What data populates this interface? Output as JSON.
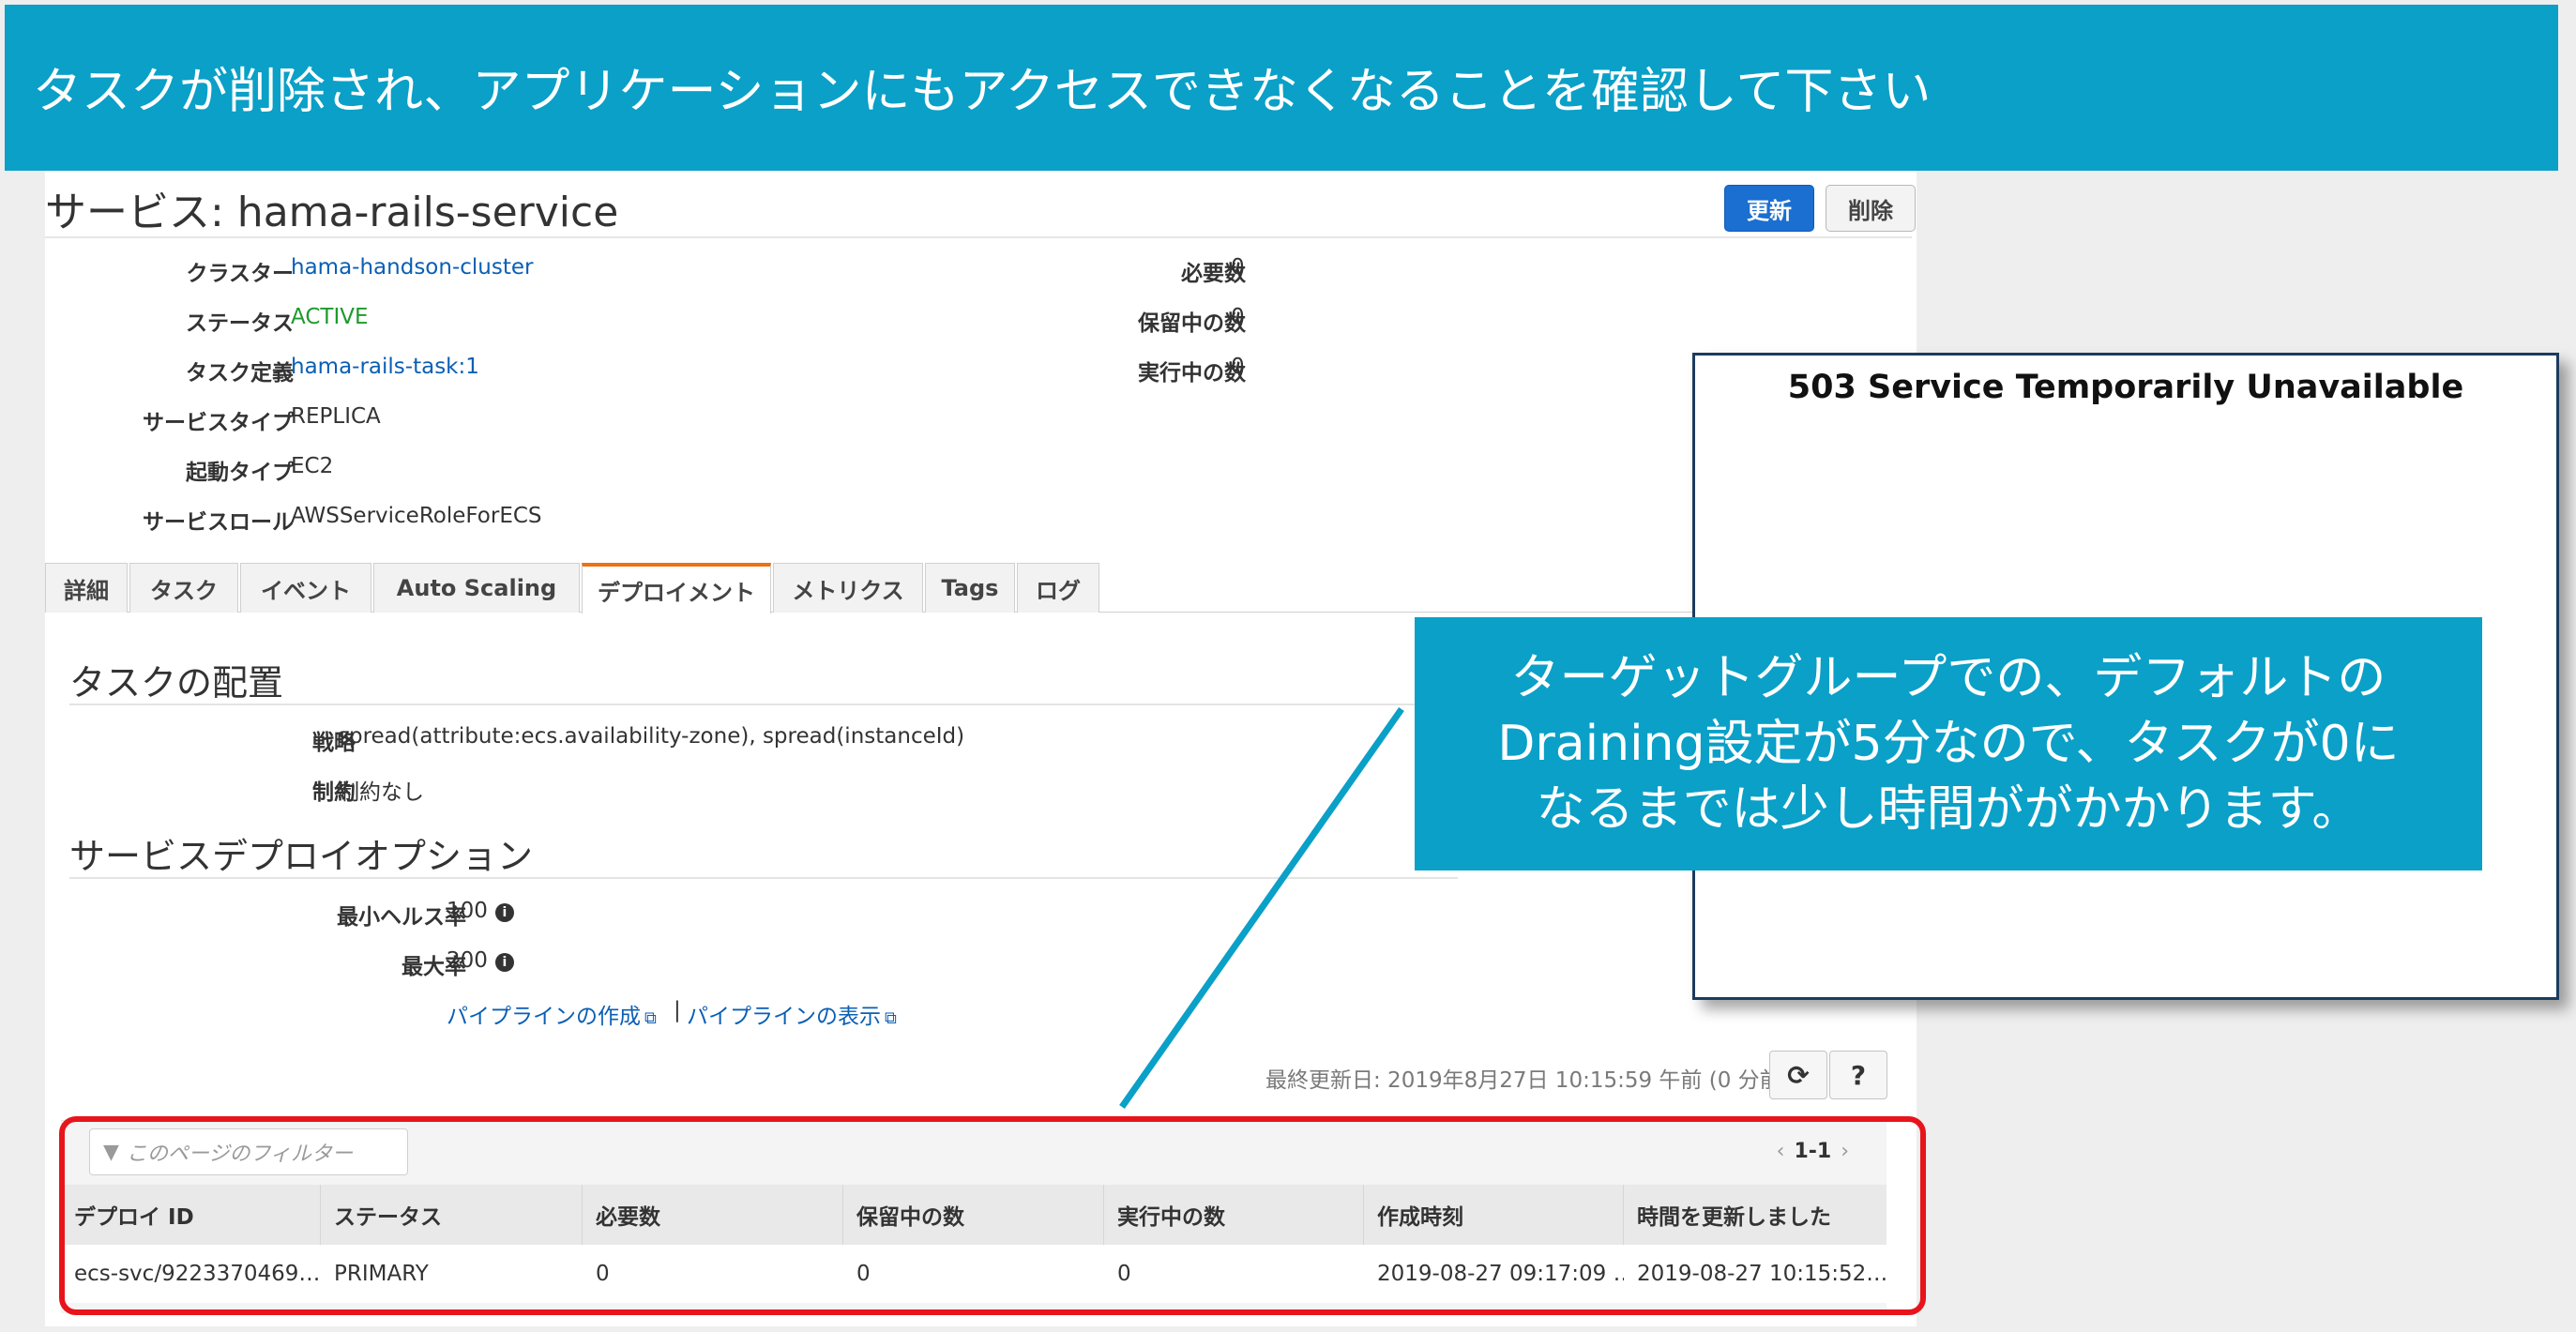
{
  "banner": {
    "text": "タスクが削除され、アプリケーションにもアクセスできなくなることを確認して下さい"
  },
  "service": {
    "title": "サービス: hama-rails-service",
    "update_button": "更新",
    "delete_button": "削除",
    "details_left": [
      {
        "label": "クラスター",
        "value": "hama-handson-cluster",
        "kind": "link"
      },
      {
        "label": "ステータス",
        "value": "ACTIVE",
        "kind": "ok"
      },
      {
        "label": "タスク定義",
        "value": "hama-rails-task:1",
        "kind": "link"
      },
      {
        "label": "サービスタイプ",
        "value": "REPLICA",
        "kind": "text"
      },
      {
        "label": "起動タイプ",
        "value": "EC2",
        "kind": "text"
      },
      {
        "label": "サービスロール",
        "value": "AWSServiceRoleForECS",
        "kind": "text"
      }
    ],
    "details_right": [
      {
        "label": "必要数",
        "value": "0"
      },
      {
        "label": "保留中の数",
        "value": "0"
      },
      {
        "label": "実行中の数",
        "value": "0"
      }
    ]
  },
  "tabs": [
    "詳細",
    "タスク",
    "イベント",
    "Auto Scaling",
    "デプロイメント",
    "メトリクス",
    "Tags",
    "ログ"
  ],
  "active_tab": "デプロイメント",
  "placement": {
    "title": "タスクの配置",
    "strategy_label": "戦略",
    "strategy_value": "spread(attribute:ecs.availability-zone), spread(instanceId)",
    "constraint_label": "制約",
    "constraint_value": "制約なし"
  },
  "deploy_options": {
    "title": "サービスデプロイオプション",
    "min_health_label": "最小ヘルス率",
    "min_health_value": "100",
    "max_label": "最大率",
    "max_value": "200",
    "pipeline_create": "パイプラインの作成",
    "pipeline_view": "パイプラインの表示",
    "separator": "|"
  },
  "last_updated": "最終更新日: 2019年8月27日 10:15:59 午前 (0 分前)",
  "table": {
    "filter_placeholder": "このページのフィルター",
    "pager": "1-1",
    "headers": [
      "デプロイ ID",
      "ステータス",
      "必要数",
      "保留中の数",
      "実行中の数",
      "作成時刻",
      "時間を更新しました"
    ],
    "rows": [
      [
        "ecs-svc/9223370469…",
        "PRIMARY",
        "0",
        "0",
        "0",
        "2019-08-27 09:17:09 …",
        "2019-08-27 10:15:52…"
      ]
    ]
  },
  "popup": {
    "text": "503 Service Temporarily Unavailable"
  },
  "callout": {
    "lines": [
      "ターゲットグループでの、デフォルトの",
      "Draining設定が5分なので、タスクが0に",
      "なるまでは少し時間ががかかります。"
    ]
  },
  "colors": {
    "accent": "#0aa0c7",
    "link": "#0a5fb4",
    "active": "#1d9a2c",
    "primary_button": "#1a6fd0",
    "highlight": "#e8141b",
    "tab_active": "#ec7211"
  },
  "icons": [
    "info-icon",
    "external-link-icon",
    "refresh-icon",
    "help-icon",
    "filter-icon",
    "chevron-left-icon",
    "chevron-right-icon"
  ]
}
